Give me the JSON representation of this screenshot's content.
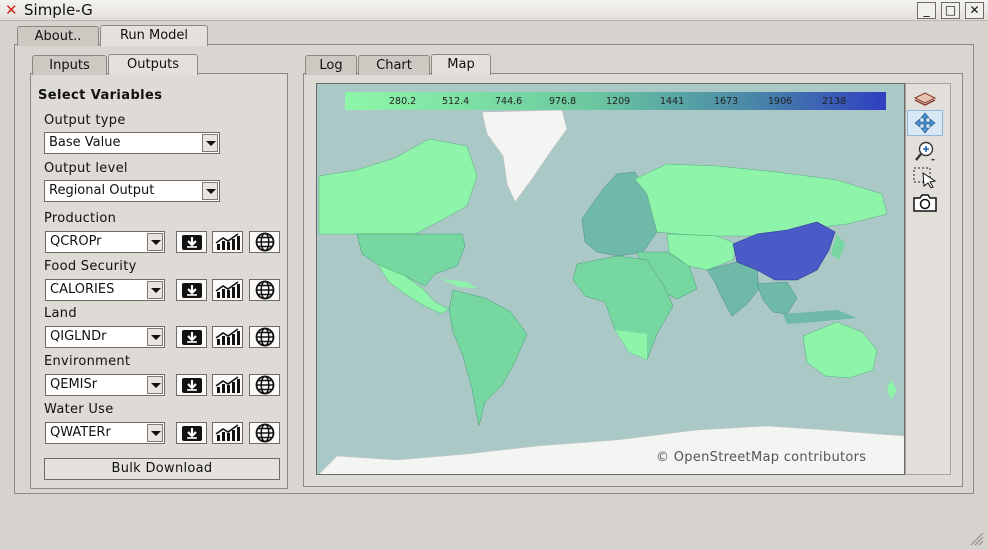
{
  "window": {
    "title": "Simple-G",
    "controls": {
      "minimize": "_",
      "maximize": "□",
      "close": "✕"
    }
  },
  "main_tabs": [
    {
      "label": "About..",
      "active": false
    },
    {
      "label": "Run Model",
      "active": true
    }
  ],
  "side_tabs": [
    {
      "label": "Inputs",
      "active": false
    },
    {
      "label": "Outputs",
      "active": true
    }
  ],
  "view_tabs": [
    {
      "label": "Log",
      "active": false
    },
    {
      "label": "Chart",
      "active": false
    },
    {
      "label": "Map",
      "active": true
    }
  ],
  "outputs": {
    "heading": "Select Variables",
    "output_type": {
      "label": "Output type",
      "value": "Base Value"
    },
    "output_level": {
      "label": "Output level",
      "value": "Regional Output"
    },
    "groups": [
      {
        "label": "Production",
        "value": "QCROPr"
      },
      {
        "label": "Food Security",
        "value": "CALORIES"
      },
      {
        "label": "Land",
        "value": "QIGLNDr"
      },
      {
        "label": "Environment",
        "value": "QEMISr"
      },
      {
        "label": "Water Use",
        "value": "QWATERr"
      }
    ],
    "icons": [
      "download-icon",
      "chart-icon",
      "globe-icon"
    ],
    "bulk_download": "Bulk Download"
  },
  "map": {
    "legend": {
      "values": [
        "280.2",
        "512.4",
        "744.6",
        "976.8",
        "1209",
        "1441",
        "1673",
        "1906",
        "2138"
      ],
      "color_low": "#8df7a8",
      "color_high": "#2f3fc0"
    },
    "attribution": "© OpenStreetMap contributors",
    "colors": {
      "ocean": "#aac9c6",
      "land_light": "#8cf3a8",
      "land_mid": "#76d8a0",
      "land_teal": "#6eb9a8",
      "china": "#4a5bc8"
    }
  },
  "toolbar": [
    "layers-icon",
    "pan-icon",
    "zoom-icon",
    "select-icon",
    "camera-icon"
  ]
}
